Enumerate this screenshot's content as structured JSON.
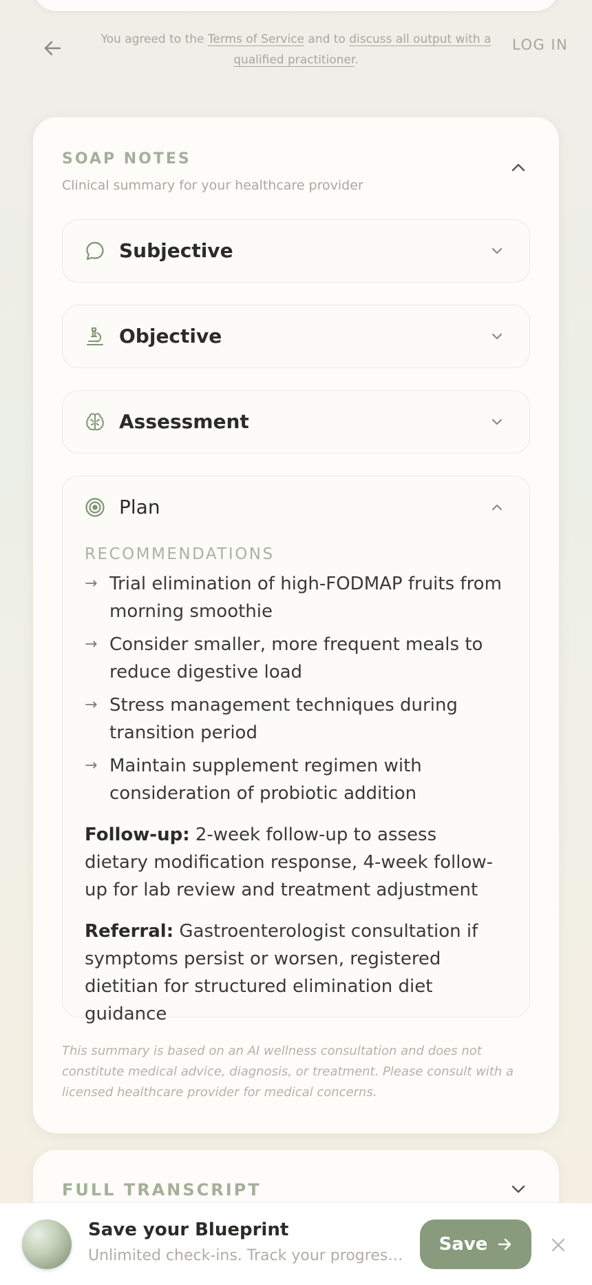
{
  "header": {
    "terms_prefix": "You agreed to the ",
    "terms_link": "Terms of Service",
    "terms_middle": " and to ",
    "discuss_link": "discuss all output with a qualified practitioner",
    "terms_suffix": ".",
    "login_label": "LOG IN",
    "back_icon": "arrow-left-icon"
  },
  "soap": {
    "title": "SOAP NOTES",
    "subtitle": "Clinical summary for your healthcare provider",
    "sections": [
      {
        "label": "Subjective",
        "icon": "chat-bubble-icon",
        "expanded": false
      },
      {
        "label": "Objective",
        "icon": "microscope-icon",
        "expanded": false
      },
      {
        "label": "Assessment",
        "icon": "brain-icon",
        "expanded": false
      },
      {
        "label": "Plan",
        "icon": "target-icon",
        "expanded": true
      }
    ],
    "plan": {
      "recommendations_title": "RECOMMENDATIONS",
      "recommendations": [
        "Trial elimination of high-FODMAP fruits from morning smoothie",
        "Consider smaller, more frequent meals to reduce digestive load",
        "Stress management techniques during transition period",
        "Maintain supplement regimen with consideration of probiotic addition"
      ],
      "followup_label": "Follow-up:",
      "followup_text": " 2-week follow-up to assess dietary modification response, 4-week follow-up for lab review and treatment adjustment",
      "referral_label": "Referral:",
      "referral_text": " Gastroenterologist consultation if symptoms persist or worsen, registered dietitian for structured elimination diet guidance"
    },
    "disclaimer": "This summary is based on an AI wellness consultation and does not constitute medical advice, diagnosis, or treatment. Please consult with a licensed healthcare provider for medical concerns."
  },
  "transcript": {
    "title": "FULL TRANSCRIPT"
  },
  "savebar": {
    "title": "Save your Blueprint",
    "subtitle": "Unlimited check-ins. Track your progress. Get personalized insights.",
    "button_label": "Save"
  },
  "colors": {
    "accent": "#889b7c",
    "label_green": "#a4b09a",
    "muted": "#a8a69c"
  }
}
